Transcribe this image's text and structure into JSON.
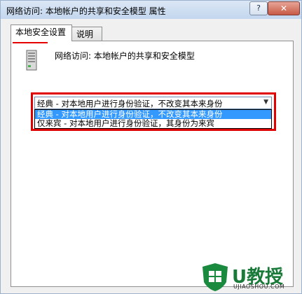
{
  "window": {
    "title": "网络访问: 本地帐户的共享和安全模型 属性",
    "help_label": "?",
    "close_label": "✕"
  },
  "tabs": [
    {
      "label": "本地安全设置",
      "active": true
    },
    {
      "label": "说明",
      "active": false
    }
  ],
  "panel": {
    "policy_label": "网络访问: 本地帐户的共享和安全模型",
    "policy_icon": "server-icon",
    "select": {
      "value": "经典 - 对本地用户进行身份验证，不改变其本来身份",
      "options": [
        "经典 - 对本地用户进行身份验证，不改变其本来身份",
        "仅来宾 - 对本地用户进行身份验证，其身份为来宾"
      ]
    }
  },
  "watermark": {
    "brand": "U教授",
    "url": "UJIAOSHOU.COM"
  },
  "colors": {
    "highlight": "#e00000",
    "selection": "#3399ff",
    "brand": "#1a7a3a"
  }
}
